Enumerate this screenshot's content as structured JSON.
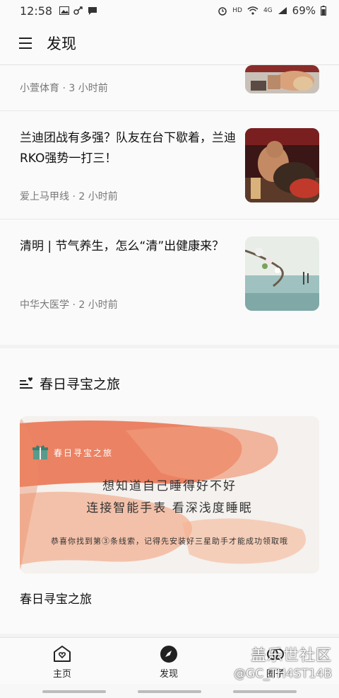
{
  "status_bar": {
    "time": "12:58",
    "network_label": "HD",
    "signal_label": "4G",
    "battery": "69%",
    "icons": [
      "image-icon",
      "link-icon",
      "message-icon",
      "alarm-icon",
      "wifi-icon",
      "signal-icon",
      "battery-icon"
    ]
  },
  "app_bar": {
    "title": "发现",
    "menu_icon": "hamburger-icon"
  },
  "feed": {
    "items": [
      {
        "title": "",
        "meta": "小萱体育 · 3 小时前"
      },
      {
        "title": "兰迪团战有多强？队友在台下歇着，兰迪RKO强势一打三！",
        "meta": "爱上马甲线 · 2 小时前"
      },
      {
        "title": "清明 | 节气养生，怎么“清”出健康来？",
        "meta": "中华大医学 · 2 小时前"
      }
    ]
  },
  "section": {
    "icon": "heart-list-icon",
    "title": "春日寻宝之旅",
    "banner": {
      "logo_text": "春日寻宝之旅",
      "line1": "想知道自己睡得好不好",
      "line2": "连接智能手表 看深浅度睡眠",
      "line3": "恭喜你找到第③条线索，记得先安装好三星助手才能成功领取哦"
    },
    "caption": "春日寻宝之旅"
  },
  "tabs": [
    {
      "label": "主页",
      "icon": "home-heart-icon"
    },
    {
      "label": "发现",
      "icon": "compass-icon"
    },
    {
      "label": "圈子",
      "icon": "circles-icon"
    }
  ],
  "watermark": {
    "line1": "盖乐世社区",
    "line2": "@GC_TH4ST14B"
  },
  "colors": {
    "accent": "#222222",
    "banner_ink": "#e8795a",
    "background": "#fafafa"
  }
}
